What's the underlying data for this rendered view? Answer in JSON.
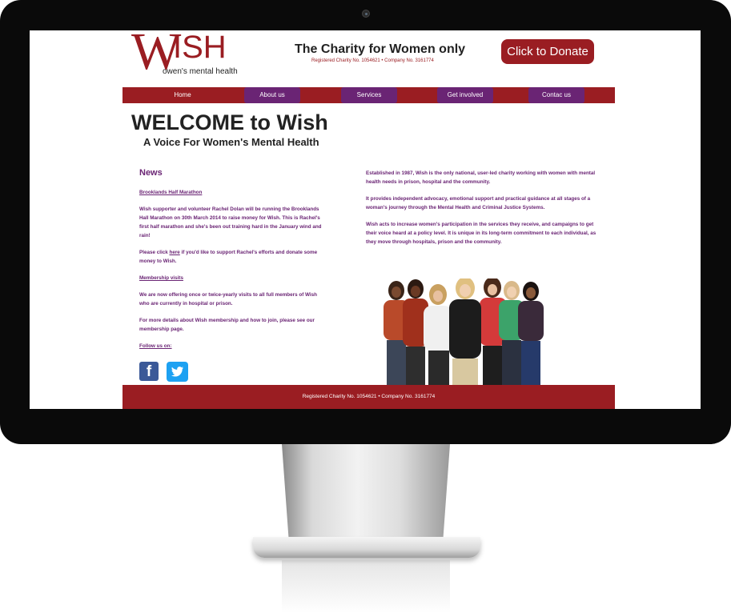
{
  "header": {
    "logo_letter": "W",
    "logo_rest": "ISH",
    "logo_tagline": "owen's mental health",
    "tagline": "The Charity for Women only",
    "registration": "Registered Charity No. 1054621 • Company No. 3161774",
    "donate_label": "Click to Donate"
  },
  "nav": {
    "items": [
      {
        "label": "Home"
      },
      {
        "label": "About us"
      },
      {
        "label": "Services"
      },
      {
        "label": "Get involved"
      },
      {
        "label": "Contac us"
      }
    ]
  },
  "hero": {
    "title": "WELCOME to Wish",
    "subtitle": "A Voice For Women's Mental Health"
  },
  "news": {
    "heading": "News",
    "item1_title": "Brooklands Half Marathon",
    "item1_body": "Wish supporter and volunteer Rachel Dolan will be running the Brooklands Hall Marathon on 30th March 2014 to raise money for Wish. This is Rachel's first half marathon and she's been out training hard in the January wind and rain!",
    "item1_cta_pre": "Please click ",
    "item1_cta_link": "here",
    "item1_cta_post": " if you'd like to support Rachel's efforts and donate some money to Wish.",
    "item2_title": "Membership visits",
    "item2_body": "We are now offering once or twice-yearly visits to all full members of Wish who are currently in hospital or prison.",
    "item2_more": "For more details about Wish membership and how to join, please see our membership page.",
    "follow_label": "Follow us on:"
  },
  "about": {
    "p1": "Established in 1987, Wish is the only national, user-led charity working with women with mental health needs in prison, hospital and the community.",
    "p2": "It provides independent advocacy, emotional support and practical guidance at all stages of a woman's journey through the Mental Health and Criminal Justice Systems.",
    "p3": "Wish acts to increase women's participation in the services they receive, and campaigns to get their voice heard at a policy level. It is unique in its long-term commitment to each individual, as they move through hospitals, prison and the community."
  },
  "footer": {
    "text": "Registered Charity No. 1054621 • Company No. 3161774"
  },
  "social": {
    "facebook_glyph": "f"
  },
  "colors": {
    "brand_red": "#9a1d22",
    "brand_purple": "#6a2474"
  }
}
